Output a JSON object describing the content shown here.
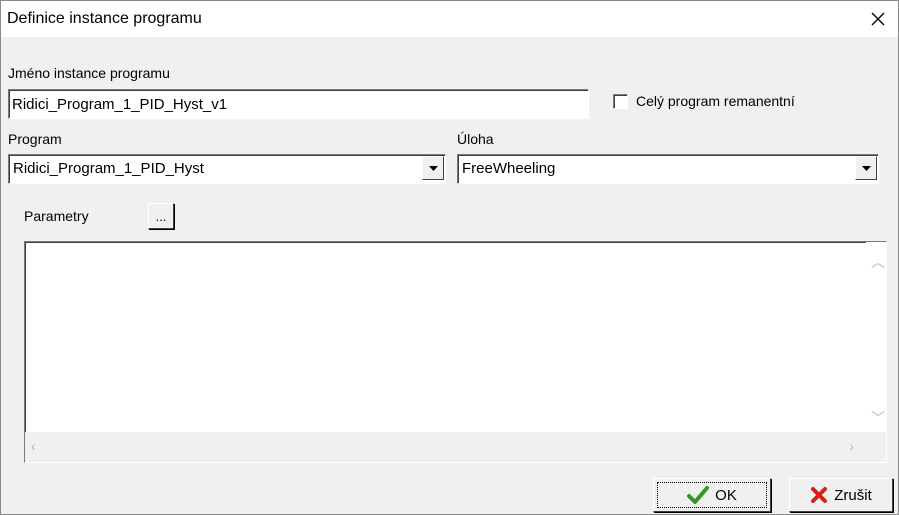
{
  "window": {
    "title": "Definice instance programu"
  },
  "form": {
    "instance_label": "Jméno instance programu",
    "instance_value": "Ridici_Program_1_PID_Hyst_v1",
    "remanent_label": "Celý program remanentní",
    "remanent_checked": false,
    "program_label": "Program",
    "program_value": "Ridici_Program_1_PID_Hyst",
    "task_label": "Úloha",
    "task_value": "FreeWheeling",
    "params_label": "Parametry",
    "params_button": "..."
  },
  "buttons": {
    "ok_label": "OK",
    "cancel_label": "Zrušit"
  },
  "icons": {
    "close": "close-icon",
    "combo_arrow": "chevron-down-icon",
    "ok": "checkmark-icon",
    "cancel": "x-cross-icon"
  },
  "colors": {
    "ok_icon": "#2e9a1f",
    "cancel_icon": "#d8201a"
  }
}
